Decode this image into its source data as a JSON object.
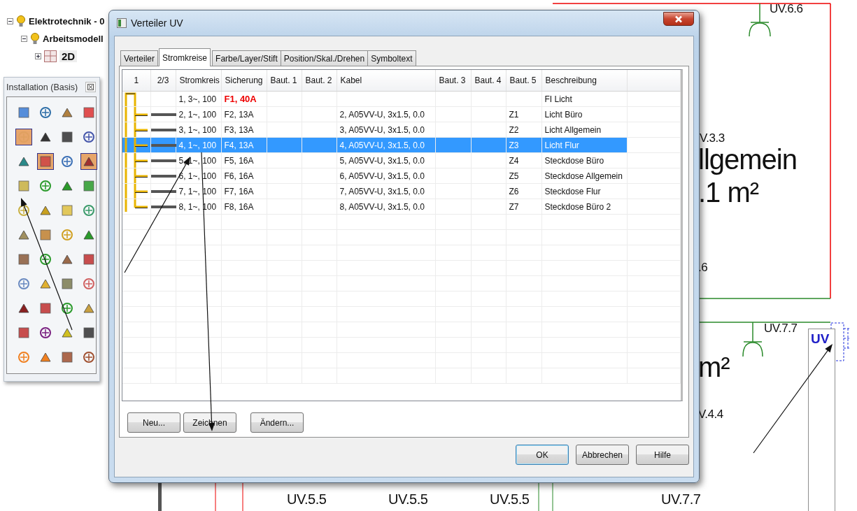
{
  "project_tree": {
    "items": [
      {
        "label": "Elektrotechnik - 0",
        "expanded": true,
        "children": [
          {
            "label": "Arbeitsmodell",
            "expanded": true,
            "children": [
              {
                "label": "2D",
                "expanded": false
              }
            ]
          }
        ]
      }
    ]
  },
  "palette": {
    "title": "Installation (Basis)",
    "tools": [
      {
        "selected": false
      },
      {
        "selected": false
      },
      {
        "selected": false
      },
      {
        "selected": false
      },
      {
        "selected": true
      },
      {
        "selected": false
      },
      {
        "selected": false
      },
      {
        "selected": false
      },
      {
        "selected": false
      },
      {
        "selected": true
      },
      {
        "selected": false
      },
      {
        "selected": true
      },
      {
        "selected": false
      },
      {
        "selected": false
      },
      {
        "selected": false
      },
      {
        "selected": false
      },
      {
        "selected": false
      },
      {
        "selected": false
      },
      {
        "selected": false
      },
      {
        "selected": false
      },
      {
        "selected": false
      },
      {
        "selected": false
      },
      {
        "selected": false
      },
      {
        "selected": false
      },
      {
        "selected": false
      },
      {
        "selected": false
      },
      {
        "selected": false
      },
      {
        "selected": false
      },
      {
        "selected": false
      },
      {
        "selected": false
      },
      {
        "selected": false
      },
      {
        "selected": false
      },
      {
        "selected": false
      },
      {
        "selected": false
      },
      {
        "selected": false
      },
      {
        "selected": false
      },
      {
        "selected": false
      },
      {
        "selected": false
      },
      {
        "selected": false
      },
      {
        "selected": false
      },
      {
        "selected": false
      },
      {
        "selected": false
      },
      {
        "selected": false
      },
      {
        "selected": false
      }
    ]
  },
  "dialog": {
    "title": "Verteiler UV",
    "tabs": [
      {
        "label": "Verteiler",
        "selected": false
      },
      {
        "label": "Stromkreise",
        "selected": true
      },
      {
        "label": "Farbe/Layer/Stift",
        "selected": false
      },
      {
        "label": "Position/Skal./Drehen",
        "selected": false
      },
      {
        "label": "Symboltext",
        "selected": false
      }
    ],
    "table": {
      "columns": [
        "1",
        "2/3",
        "Stromkreis",
        "Sicherung",
        "Baut. 1",
        "Baut. 2",
        "Kabel",
        "Baut. 3",
        "Baut. 4",
        "Baut. 5",
        "Beschreibung"
      ],
      "rows": [
        {
          "kind": "feeder",
          "selected": false,
          "stromkreis": "1, 3~, 100",
          "sicherung": "F1, 40A",
          "beschreibung": "FI Licht"
        },
        {
          "kind": "circuit",
          "selected": false,
          "stromkreis": "2, 1~, 100",
          "sicherung": "F2, 13A",
          "kabel": "2, A05VV-U, 3x1.5, 0.0",
          "baut_5": "Z1",
          "beschreibung": "Licht Büro"
        },
        {
          "kind": "circuit",
          "selected": false,
          "stromkreis": "3, 1~, 100",
          "sicherung": "F3, 13A",
          "kabel": "3, A05VV-U, 3x1.5, 0.0",
          "baut_5": "Z2",
          "beschreibung": "Licht Allgemein"
        },
        {
          "kind": "circuit",
          "selected": true,
          "stromkreis": "4, 1~, 100",
          "sicherung": "F4, 13A",
          "kabel": "4, A05VV-U, 3x1.5, 0.0",
          "baut_5": "Z3",
          "beschreibung": "Licht Flur"
        },
        {
          "kind": "circuit",
          "selected": false,
          "stromkreis": "5, 1~, 100",
          "sicherung": "F5, 16A",
          "kabel": "5, A05VV-U, 3x1.5, 0.0",
          "baut_5": "Z4",
          "beschreibung": "Steckdose Büro"
        },
        {
          "kind": "circuit",
          "selected": false,
          "stromkreis": "6, 1~, 100",
          "sicherung": "F6, 16A",
          "kabel": "6, A05VV-U, 3x1.5, 0.0",
          "baut_5": "Z5",
          "beschreibung": "Steckdose Allgemein"
        },
        {
          "kind": "circuit",
          "selected": false,
          "stromkreis": "7, 1~, 100",
          "sicherung": "F7, 16A",
          "kabel": "7, A05VV-U, 3x1.5, 0.0",
          "baut_5": "Z6",
          "beschreibung": "Steckdose Flur"
        },
        {
          "kind": "circuit",
          "selected": false,
          "stromkreis": "8, 1~, 100",
          "sicherung": "F8, 16A",
          "kabel": "8, A05VV-U, 3x1.5, 0.0",
          "baut_5": "Z7",
          "beschreibung": "Steckdose Büro 2"
        }
      ]
    },
    "action_buttons": [
      "Neu...",
      "Zeichnen",
      "Ändern..."
    ],
    "footer_buttons": [
      {
        "label": "OK",
        "default": true
      },
      {
        "label": "Abbrechen",
        "default": false
      },
      {
        "label": "Hilfe",
        "default": false
      }
    ]
  },
  "drawing": {
    "labels": [
      {
        "text": "UV.6.6",
        "kind": "tag"
      },
      {
        "text": "V.3.3",
        "kind": "tag"
      },
      {
        "text": "llgemein",
        "kind": "room"
      },
      {
        "text": ".1 m²",
        "kind": "room"
      },
      {
        "text": ".6",
        "kind": "tag"
      },
      {
        "text": "UV.7.7",
        "kind": "tag"
      },
      {
        "text": "UV",
        "kind": "panel"
      },
      {
        "text": "m²",
        "kind": "room"
      },
      {
        "text": "V.4.4",
        "kind": "tag"
      },
      {
        "text": "UV.5.5",
        "kind": "bottom"
      },
      {
        "text": "UV.5.5",
        "kind": "bottom"
      },
      {
        "text": "UV.5.5",
        "kind": "bottom"
      },
      {
        "text": "UV.7.7",
        "kind": "bottom"
      }
    ]
  }
}
